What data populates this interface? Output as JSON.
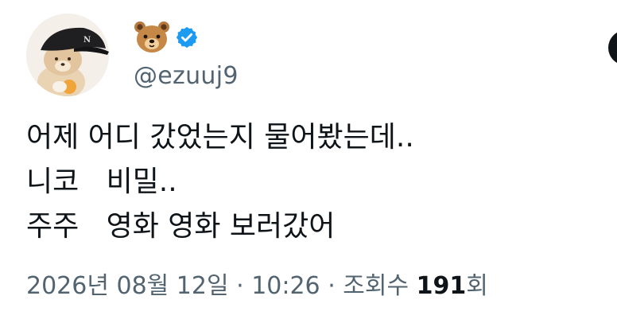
{
  "author": {
    "display_icon": "bear-face-emoji",
    "verified_icon": "verified-badge-icon",
    "verified_color": "#1d9bf0",
    "handle": "@ezuuj9"
  },
  "tweet": {
    "lines": [
      "어제 어디 갔었는지 물어봤는데..",
      "니코   비밀..",
      "주주   영화 영화 보러갔어"
    ]
  },
  "meta": {
    "date": "2026년 08월 12일",
    "separator": " · ",
    "time": "10:26",
    "views_label": "조회수 ",
    "views_count": "191",
    "views_suffix": "회"
  }
}
